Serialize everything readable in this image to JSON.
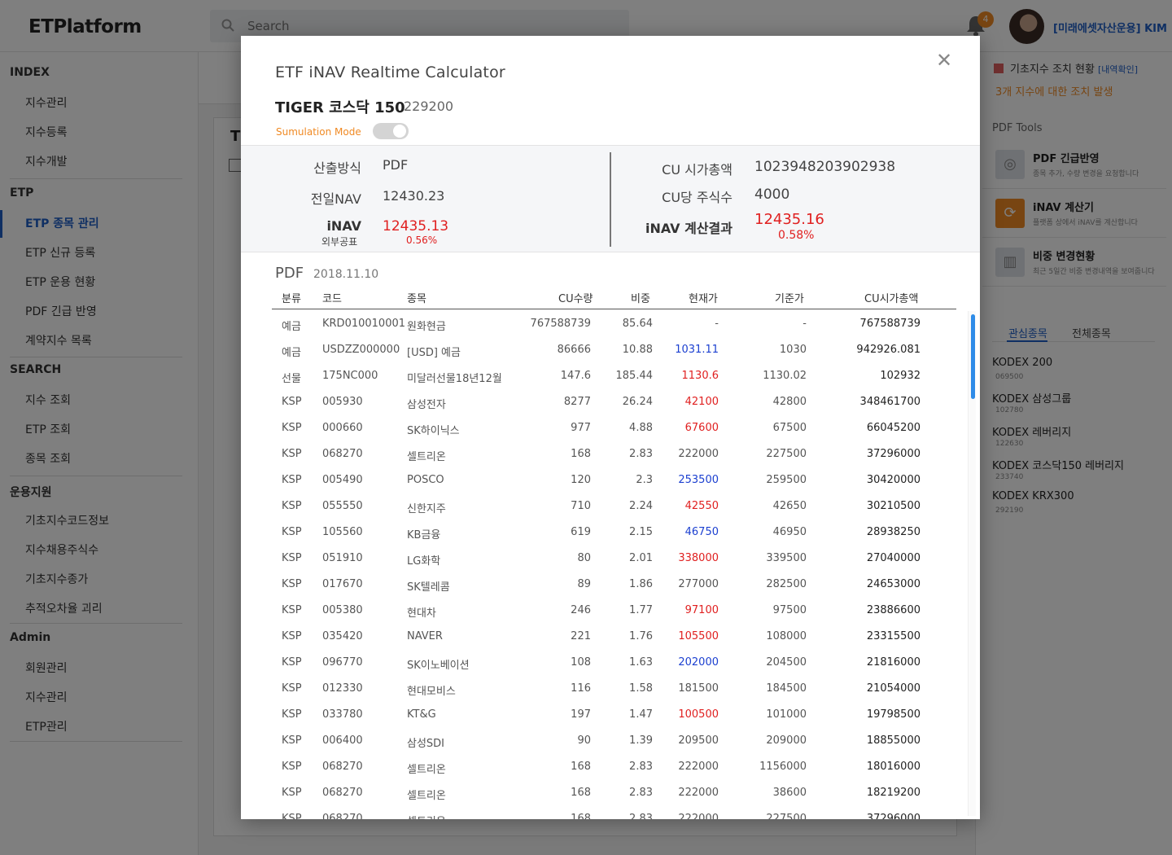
{
  "app": {
    "logo": "ETPlatform",
    "search_placeholder": "Search",
    "notification_count": "4",
    "user_name": "[미래에셋자산운용] KIM"
  },
  "sidebar": {
    "sections": [
      {
        "title": "INDEX",
        "items": [
          "지수관리",
          "지수등록",
          "지수개발"
        ]
      },
      {
        "title": "ETP",
        "items": [
          "ETP 종목 관리",
          "ETP 신규 등록",
          "ETP 운용 현황",
          "PDF 긴급 반영",
          "계약지수 목록"
        ]
      },
      {
        "title": "SEARCH",
        "items": [
          "지수 조회",
          "ETP 조회",
          "종목 조회"
        ]
      },
      {
        "title": "운용지원",
        "items": [
          "기초지수코드정보",
          "지수채용주식수",
          "기초지수종가",
          "추적오차율 괴리"
        ]
      },
      {
        "title": "Admin",
        "items": [
          "회원관리",
          "지수관리",
          "ETP관리"
        ]
      }
    ],
    "active_item": "ETP 종목 관리"
  },
  "right_panel": {
    "alert_title": "기초지수 조치 현황",
    "alert_link": "[내역확인]",
    "alert_message": "3개 지수에 대한 조치 발생",
    "tools_title": "PDF Tools",
    "tools": [
      {
        "title": "PDF 긴급반영",
        "desc": "종목 추가, 수량 변경을 요청합니다",
        "icon": "lifebuoy-icon"
      },
      {
        "title": "iNAV 계산기",
        "desc": "플랫폼 상에서 iNAV를 계산합니다",
        "icon": "refresh-icon"
      },
      {
        "title": "비중 변경현황",
        "desc": "최근 5일간 비중 변경내역을 보여줍니다",
        "icon": "bar-chart-icon"
      }
    ],
    "tabs": [
      "관심종목",
      "전체종목"
    ],
    "watchlist": [
      {
        "name": "KODEX 200",
        "code": "069500"
      },
      {
        "name": "KODEX 삼성그룹",
        "code": "102780"
      },
      {
        "name": "KODEX 레버리지",
        "code": "122630"
      },
      {
        "name": "KODEX 코스닥150 레버리지",
        "code": "233740"
      },
      {
        "name": "KODEX KRX300",
        "code": "292190"
      }
    ]
  },
  "modal": {
    "title": "ETF iNAV Realtime Calculator",
    "etf_name": "TIGER 코스닥 150",
    "etf_code": "229200",
    "simulation_label": "Sumulation Mode",
    "simulation_on": false,
    "summary": {
      "method_label": "산출방식",
      "method_value": "PDF",
      "prev_nav_label": "전일NAV",
      "prev_nav_value": "12430.23",
      "inav_label": "iNAV",
      "inav_sub_label": "외부공표",
      "inav_value": "12435.13",
      "inav_change": "0.56%",
      "cu_cap_label": "CU 시가총액",
      "cu_cap_value": "1023948203902938",
      "cu_shares_label": "CU당 주식수",
      "cu_shares_value": "4000",
      "calc_label": "iNAV 계산결과",
      "calc_value": "12435.16",
      "calc_change": "0.58%"
    },
    "pdf_title": "PDF",
    "pdf_date": "2018.11.10",
    "columns": [
      "분류",
      "코드",
      "종목",
      "CU수량",
      "비중",
      "현재가",
      "기준가",
      "CU시가총액"
    ],
    "rows": [
      [
        "예금",
        "KRD010010001",
        "원화현금",
        "767588739",
        "85.64",
        "-",
        "-",
        "767588739",
        "flat"
      ],
      [
        "예금",
        "USDZZ000000",
        "[USD] 예금",
        "86666",
        "10.88",
        "1031.11",
        "1030",
        "942926.081",
        "down"
      ],
      [
        "선물",
        "175NC000",
        "미달러선물18년12월",
        "147.6",
        "185.44",
        "1130.6",
        "1130.02",
        "102932",
        "up"
      ],
      [
        "KSP",
        "005930",
        "삼성전자",
        "8277",
        "26.24",
        "42100",
        "42800",
        "348461700",
        "up"
      ],
      [
        "KSP",
        "000660",
        "SK하이닉스",
        "977",
        "4.88",
        "67600",
        "67500",
        "66045200",
        "up"
      ],
      [
        "KSP",
        "068270",
        "셀트리온",
        "168",
        "2.83",
        "222000",
        "227500",
        "37296000",
        "flat"
      ],
      [
        "KSP",
        "005490",
        "POSCO",
        "120",
        "2.3",
        "253500",
        "259500",
        "30420000",
        "down"
      ],
      [
        "KSP",
        "055550",
        "신한지주",
        "710",
        "2.24",
        "42550",
        "42650",
        "30210500",
        "up"
      ],
      [
        "KSP",
        "105560",
        "KB금융",
        "619",
        "2.15",
        "46750",
        "46950",
        "28938250",
        "down"
      ],
      [
        "KSP",
        "051910",
        "LG화학",
        "80",
        "2.01",
        "338000",
        "339500",
        "27040000",
        "up"
      ],
      [
        "KSP",
        "017670",
        "SK텔레콤",
        "89",
        "1.86",
        "277000",
        "282500",
        "24653000",
        "flat"
      ],
      [
        "KSP",
        "005380",
        "현대차",
        "246",
        "1.77",
        "97100",
        "97500",
        "23886600",
        "up"
      ],
      [
        "KSP",
        "035420",
        "NAVER",
        "221",
        "1.76",
        "105500",
        "108000",
        "23315500",
        "up"
      ],
      [
        "KSP",
        "096770",
        "SK이노베이션",
        "108",
        "1.63",
        "202000",
        "204500",
        "21816000",
        "down"
      ],
      [
        "KSP",
        "012330",
        "현대모비스",
        "116",
        "1.58",
        "181500",
        "184500",
        "21054000",
        "flat"
      ],
      [
        "KSP",
        "033780",
        "KT&G",
        "197",
        "1.47",
        "100500",
        "101000",
        "19798500",
        "up"
      ],
      [
        "KSP",
        "006400",
        "삼성SDI",
        "90",
        "1.39",
        "209500",
        "209000",
        "18855000",
        "flat"
      ],
      [
        "KSP",
        "068270",
        "셀트리온",
        "168",
        "2.83",
        "222000",
        "1156000",
        "18016000",
        "flat"
      ],
      [
        "KSP",
        "068270",
        "셀트리온",
        "168",
        "2.83",
        "222000",
        "38600",
        "18219200",
        "flat"
      ],
      [
        "KSP",
        "068270",
        "셀트리온",
        "168",
        "2.83",
        "222000",
        "227500",
        "37296000",
        "flat"
      ]
    ]
  },
  "colors": {
    "accent_blue": "#1f5fc6",
    "up_red": "#e02020",
    "down_blue": "#1c40d0",
    "warning_orange": "#f08a24",
    "scrollbar_blue": "#2f8ce8"
  }
}
